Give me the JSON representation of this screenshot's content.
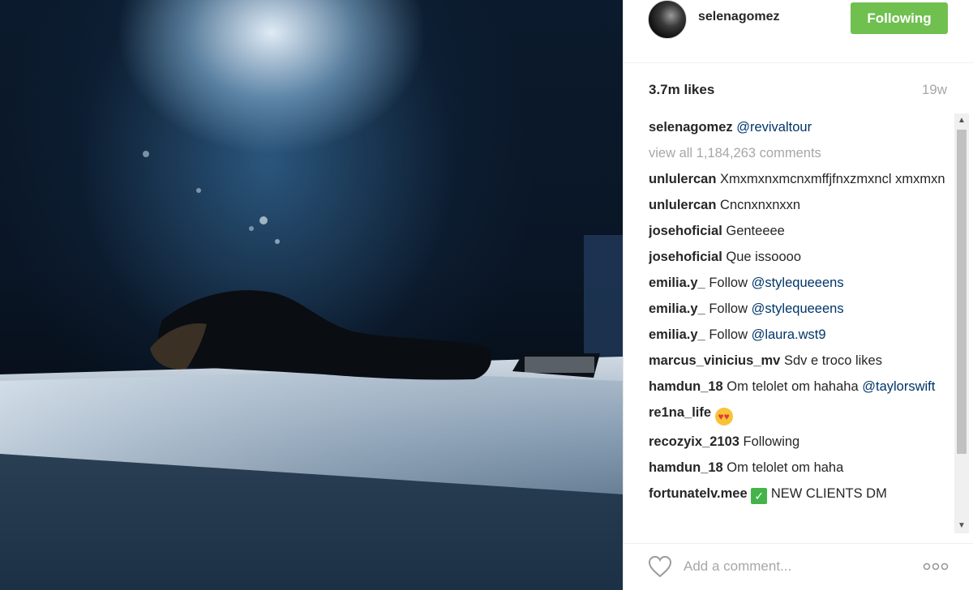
{
  "post": {
    "username": "selenagomez",
    "follow_label": "Following",
    "likes": "3.7m likes",
    "age": "19w",
    "view_all": "view all 1,184,263 comments",
    "add_comment_placeholder": "Add a comment..."
  },
  "caption": {
    "author": "selenagomez",
    "mention": "@revivaltour"
  },
  "comments": [
    {
      "author": "unlulercan",
      "text": "Xmxmxnxmcnxmffjfnxzmxncl xmxmxn"
    },
    {
      "author": "unlulercan",
      "text": "Cncnxnxnxxn"
    },
    {
      "author": "josehoficial",
      "text": "Genteeee"
    },
    {
      "author": "josehoficial",
      "text": "Que issoooo"
    },
    {
      "author": "emilia.y_",
      "text": "Follow",
      "mention": "@stylequeeens"
    },
    {
      "author": "emilia.y_",
      "text": "Follow",
      "mention": "@stylequeeens"
    },
    {
      "author": "emilia.y_",
      "text": "Follow",
      "mention": "@laura.wst9"
    },
    {
      "author": "marcus_vinicius_mv",
      "text": "Sdv e troco likes"
    },
    {
      "author": "hamdun_18",
      "text": "Om telolet om hahaha",
      "mention": "@taylorswift"
    },
    {
      "author": "re1na_life",
      "emoji": "heart-eyes-emoji"
    },
    {
      "author": "recozyix_2103",
      "text": "Following"
    },
    {
      "author": "hamdun_18",
      "text": "Om telolet om haha"
    },
    {
      "author": "fortunatelv.mee",
      "text": "NEW CLIENTS DM",
      "emoji": "check-mark-emoji"
    }
  ],
  "icons": {
    "like": "heart-outline-icon",
    "more": "more-options-icon",
    "scroll_up": "scroll-up-arrow-icon",
    "scroll_down": "scroll-down-arrow-icon"
  },
  "colors": {
    "follow_button": "#70c050",
    "mention": "#003569",
    "muted": "#a5a7aa",
    "text": "#262626"
  }
}
